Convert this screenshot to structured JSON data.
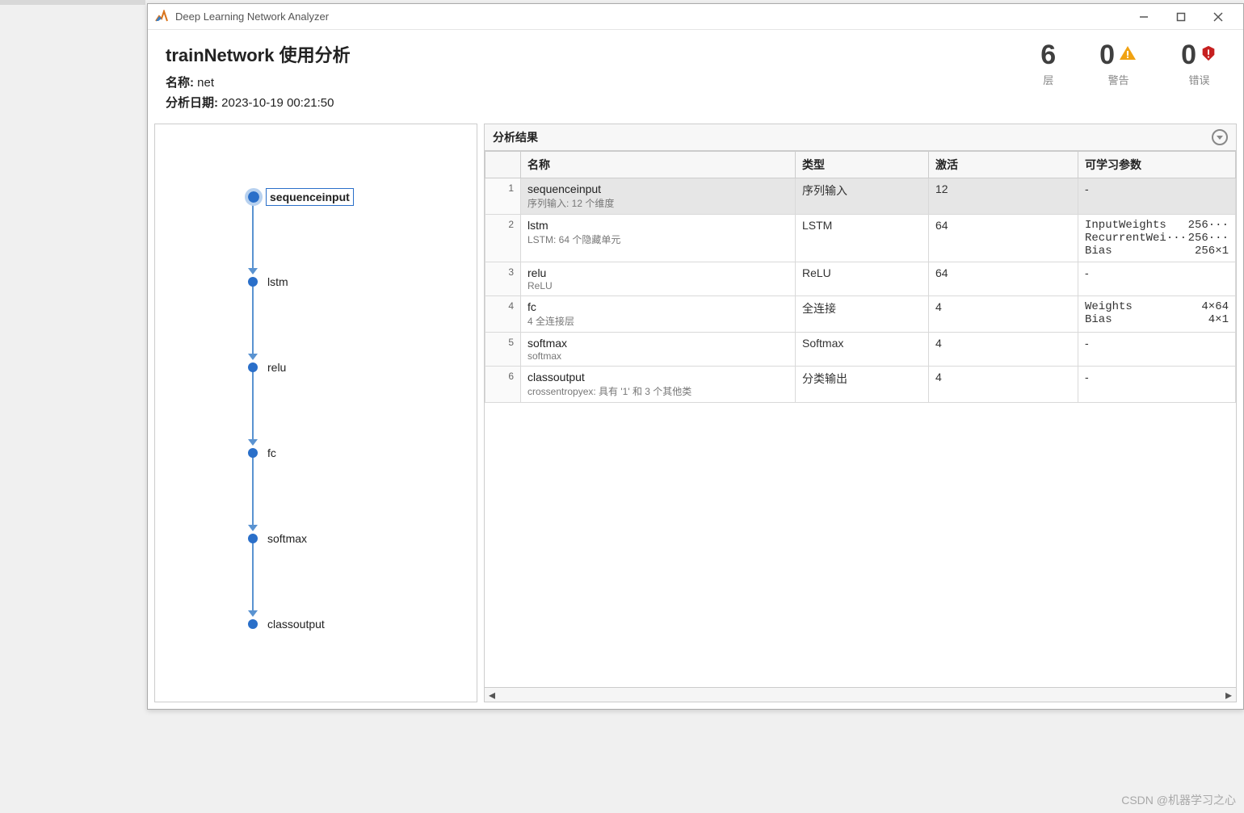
{
  "window": {
    "title": "Deep Learning Network Analyzer"
  },
  "header": {
    "title": "trainNetwork 使用分析",
    "name_label": "名称:",
    "name_value": "net",
    "date_label": "分析日期:",
    "date_value": "2023-10-19 00:21:50"
  },
  "stats": {
    "layers": {
      "num": "6",
      "label": "层"
    },
    "warnings": {
      "num": "0",
      "label": "警告"
    },
    "errors": {
      "num": "0",
      "label": "错误"
    }
  },
  "graph": {
    "nodes": [
      {
        "label": "sequenceinput",
        "selected": true
      },
      {
        "label": "lstm",
        "selected": false
      },
      {
        "label": "relu",
        "selected": false
      },
      {
        "label": "fc",
        "selected": false
      },
      {
        "label": "softmax",
        "selected": false
      },
      {
        "label": "classoutput",
        "selected": false
      }
    ]
  },
  "results": {
    "title": "分析结果",
    "columns": {
      "name": "名称",
      "type": "类型",
      "activation": "激活",
      "learnable": "可学习参数"
    },
    "rows": [
      {
        "idx": "1",
        "name": "sequenceinput",
        "sub": "序列输入: 12 个维度",
        "type": "序列输入",
        "activation": "12",
        "learn": "-",
        "selected": true
      },
      {
        "idx": "2",
        "name": "lstm",
        "sub": "LSTM: 64 个隐藏单元",
        "type": "LSTM",
        "activation": "64",
        "learn_params": [
          {
            "k": "InputWeights",
            "v": "256···"
          },
          {
            "k": "RecurrentWei···",
            "v": "256···"
          },
          {
            "k": "Bias",
            "v": "256×1"
          }
        ]
      },
      {
        "idx": "3",
        "name": "relu",
        "sub": "ReLU",
        "type": "ReLU",
        "activation": "64",
        "learn": "-"
      },
      {
        "idx": "4",
        "name": "fc",
        "sub": "4 全连接层",
        "type": "全连接",
        "activation": "4",
        "learn_params": [
          {
            "k": "Weights",
            "v": "4×64"
          },
          {
            "k": "Bias",
            "v": "4×1"
          }
        ]
      },
      {
        "idx": "5",
        "name": "softmax",
        "sub": "softmax",
        "type": "Softmax",
        "activation": "4",
        "learn": "-"
      },
      {
        "idx": "6",
        "name": "classoutput",
        "sub": "crossentropyex: 具有 '1' 和 3 个其他类",
        "type": "分类输出",
        "activation": "4",
        "learn": "-"
      }
    ]
  },
  "watermark": "CSDN @机器学习之心"
}
